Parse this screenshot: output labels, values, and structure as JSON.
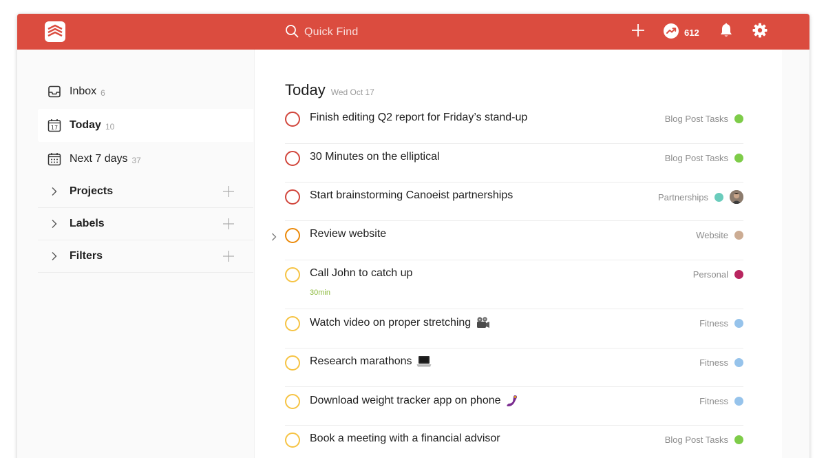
{
  "topbar": {
    "quick_find_placeholder": "Quick Find",
    "karma_count": "612",
    "brand_color": "#db4c3f"
  },
  "sidebar": {
    "items": [
      {
        "label": "Inbox",
        "count": "6",
        "icon": "inbox-icon"
      },
      {
        "label": "Today",
        "count": "10",
        "icon": "calendar-today-icon",
        "day": "17"
      },
      {
        "label": "Next 7 days",
        "count": "37",
        "icon": "calendar-week-icon"
      }
    ],
    "sections": [
      {
        "label": "Projects"
      },
      {
        "label": "Labels"
      },
      {
        "label": "Filters"
      }
    ]
  },
  "main": {
    "title": "Today",
    "date": "Wed Oct 17",
    "tasks": [
      {
        "text": "Finish editing Q2 report for Friday’s stand-up",
        "project": "Blog Post Tasks",
        "project_color": "#7ecc49",
        "priority_color": "#d1453b"
      },
      {
        "text": "30 Minutes on the elliptical",
        "project": "Blog Post Tasks",
        "project_color": "#7ecc49",
        "priority_color": "#d1453b"
      },
      {
        "text": "Start brainstorming Canoeist partnerships",
        "project": "Partnerships",
        "project_color": "#6accbc",
        "priority_color": "#d1453b",
        "assignee_avatar": true
      },
      {
        "text": "Review website",
        "project": "Website",
        "project_color": "#ccac93",
        "priority_color": "#eb8909",
        "expandable": true
      },
      {
        "text": "Call John to catch up",
        "project": "Personal",
        "project_color": "#b8255f",
        "priority_color": "#f6c343",
        "duration": "30min"
      },
      {
        "text": "Watch video on proper stretching",
        "emoji": "film-camera-icon",
        "project": "Fitness",
        "project_color": "#96c3eb",
        "priority_color": "#f6c343"
      },
      {
        "text": "Research marathons",
        "emoji": "laptop-icon",
        "project": "Fitness",
        "project_color": "#96c3eb",
        "priority_color": "#f6c343"
      },
      {
        "text": "Download weight tracker app on phone",
        "emoji": "phone-icon",
        "project": "Fitness",
        "project_color": "#96c3eb",
        "priority_color": "#f6c343"
      },
      {
        "text": "Book a meeting with a financial advisor",
        "project": "Blog Post Tasks",
        "project_color": "#7ecc49",
        "priority_color": "#f6c343"
      }
    ]
  }
}
